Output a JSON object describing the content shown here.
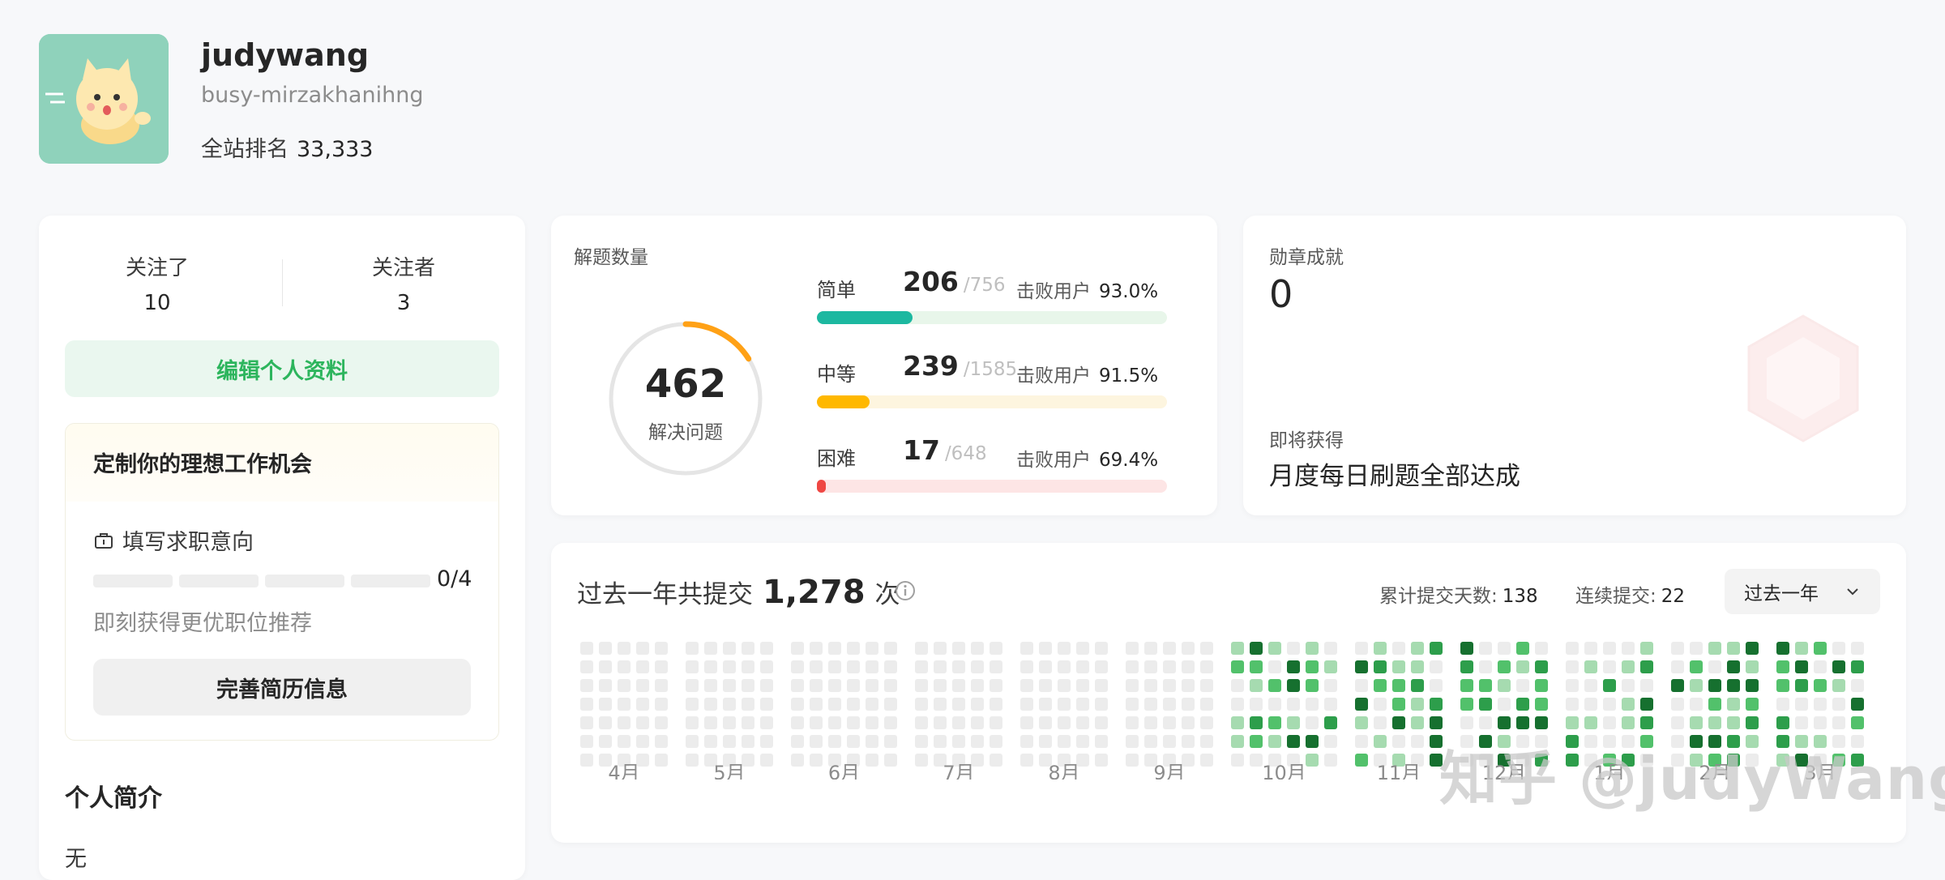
{
  "profile": {
    "username": "judywang",
    "handle": "busy-mirzakhanihng",
    "rank_label": "全站排名",
    "rank_value": "33,333"
  },
  "social": {
    "following_label": "关注了",
    "following_count": "10",
    "followers_label": "关注者",
    "followers_count": "3",
    "edit_profile": "编辑个人资料"
  },
  "job": {
    "title": "定制你的理想工作机会",
    "item_label": "填写求职意向",
    "progress": "0/4",
    "progress_done": 0,
    "progress_total": 4,
    "hint": "即刻获得更优职位推荐",
    "resume_button": "完善简历信息"
  },
  "bio": {
    "title": "个人简介",
    "text": "无"
  },
  "solved": {
    "title": "解题数量",
    "total": "462",
    "total_label": "解决问题",
    "ring_fraction": 0.16,
    "difficulties": [
      {
        "name": "简单",
        "solved": "206",
        "total": "/756",
        "beat_label": "击败用户",
        "beat": "93.0%",
        "fraction": 0.272,
        "color": "#1cb8a0",
        "track": "#e8f6ea"
      },
      {
        "name": "中等",
        "solved": "239",
        "total": "/1585",
        "beat_label": "击败用户",
        "beat": "91.5%",
        "fraction": 0.151,
        "color": "#ffb800",
        "track": "#fdf5df"
      },
      {
        "name": "困难",
        "solved": "17",
        "total": "/648",
        "beat_label": "击败用户",
        "beat": "69.4%",
        "fraction": 0.026,
        "color": "#ef4743",
        "track": "#fde5e5"
      }
    ]
  },
  "badge": {
    "title": "勋章成就",
    "count": "0",
    "upcoming_label": "即将获得",
    "upcoming_name": "月度每日刷题全部达成"
  },
  "calendar": {
    "title_prefix": "过去一年共提交",
    "submissions": "1,278",
    "unit": "次",
    "days_label": "累计提交天数:",
    "days_value": "138",
    "streak_label": "连续提交:",
    "streak_value": "22",
    "range": "过去一年",
    "months": [
      "4月",
      "5月",
      "6月",
      "7月",
      "8月",
      "9月",
      "10月",
      "11月",
      "12月",
      "1月",
      "2月",
      "3月"
    ],
    "colors": {
      "empty": "#ececec",
      "l1": "#a6dbb0",
      "l2": "#52c16b",
      "l3": "#2d9e4b",
      "l4": "#16702f"
    },
    "watermark": "知乎 @judyWang"
  }
}
